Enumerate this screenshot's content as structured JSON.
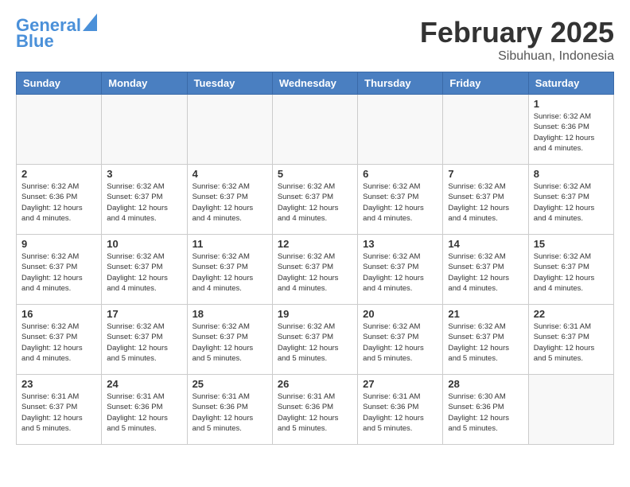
{
  "header": {
    "logo_line1": "General",
    "logo_line2": "Blue",
    "month_title": "February 2025",
    "subtitle": "Sibuhuan, Indonesia"
  },
  "weekdays": [
    "Sunday",
    "Monday",
    "Tuesday",
    "Wednesday",
    "Thursday",
    "Friday",
    "Saturday"
  ],
  "weeks": [
    [
      {
        "day": "",
        "info": ""
      },
      {
        "day": "",
        "info": ""
      },
      {
        "day": "",
        "info": ""
      },
      {
        "day": "",
        "info": ""
      },
      {
        "day": "",
        "info": ""
      },
      {
        "day": "",
        "info": ""
      },
      {
        "day": "1",
        "info": "Sunrise: 6:32 AM\nSunset: 6:36 PM\nDaylight: 12 hours\nand 4 minutes."
      }
    ],
    [
      {
        "day": "2",
        "info": "Sunrise: 6:32 AM\nSunset: 6:36 PM\nDaylight: 12 hours\nand 4 minutes."
      },
      {
        "day": "3",
        "info": "Sunrise: 6:32 AM\nSunset: 6:37 PM\nDaylight: 12 hours\nand 4 minutes."
      },
      {
        "day": "4",
        "info": "Sunrise: 6:32 AM\nSunset: 6:37 PM\nDaylight: 12 hours\nand 4 minutes."
      },
      {
        "day": "5",
        "info": "Sunrise: 6:32 AM\nSunset: 6:37 PM\nDaylight: 12 hours\nand 4 minutes."
      },
      {
        "day": "6",
        "info": "Sunrise: 6:32 AM\nSunset: 6:37 PM\nDaylight: 12 hours\nand 4 minutes."
      },
      {
        "day": "7",
        "info": "Sunrise: 6:32 AM\nSunset: 6:37 PM\nDaylight: 12 hours\nand 4 minutes."
      },
      {
        "day": "8",
        "info": "Sunrise: 6:32 AM\nSunset: 6:37 PM\nDaylight: 12 hours\nand 4 minutes."
      }
    ],
    [
      {
        "day": "9",
        "info": "Sunrise: 6:32 AM\nSunset: 6:37 PM\nDaylight: 12 hours\nand 4 minutes."
      },
      {
        "day": "10",
        "info": "Sunrise: 6:32 AM\nSunset: 6:37 PM\nDaylight: 12 hours\nand 4 minutes."
      },
      {
        "day": "11",
        "info": "Sunrise: 6:32 AM\nSunset: 6:37 PM\nDaylight: 12 hours\nand 4 minutes."
      },
      {
        "day": "12",
        "info": "Sunrise: 6:32 AM\nSunset: 6:37 PM\nDaylight: 12 hours\nand 4 minutes."
      },
      {
        "day": "13",
        "info": "Sunrise: 6:32 AM\nSunset: 6:37 PM\nDaylight: 12 hours\nand 4 minutes."
      },
      {
        "day": "14",
        "info": "Sunrise: 6:32 AM\nSunset: 6:37 PM\nDaylight: 12 hours\nand 4 minutes."
      },
      {
        "day": "15",
        "info": "Sunrise: 6:32 AM\nSunset: 6:37 PM\nDaylight: 12 hours\nand 4 minutes."
      }
    ],
    [
      {
        "day": "16",
        "info": "Sunrise: 6:32 AM\nSunset: 6:37 PM\nDaylight: 12 hours\nand 4 minutes."
      },
      {
        "day": "17",
        "info": "Sunrise: 6:32 AM\nSunset: 6:37 PM\nDaylight: 12 hours\nand 5 minutes."
      },
      {
        "day": "18",
        "info": "Sunrise: 6:32 AM\nSunset: 6:37 PM\nDaylight: 12 hours\nand 5 minutes."
      },
      {
        "day": "19",
        "info": "Sunrise: 6:32 AM\nSunset: 6:37 PM\nDaylight: 12 hours\nand 5 minutes."
      },
      {
        "day": "20",
        "info": "Sunrise: 6:32 AM\nSunset: 6:37 PM\nDaylight: 12 hours\nand 5 minutes."
      },
      {
        "day": "21",
        "info": "Sunrise: 6:32 AM\nSunset: 6:37 PM\nDaylight: 12 hours\nand 5 minutes."
      },
      {
        "day": "22",
        "info": "Sunrise: 6:31 AM\nSunset: 6:37 PM\nDaylight: 12 hours\nand 5 minutes."
      }
    ],
    [
      {
        "day": "23",
        "info": "Sunrise: 6:31 AM\nSunset: 6:37 PM\nDaylight: 12 hours\nand 5 minutes."
      },
      {
        "day": "24",
        "info": "Sunrise: 6:31 AM\nSunset: 6:36 PM\nDaylight: 12 hours\nand 5 minutes."
      },
      {
        "day": "25",
        "info": "Sunrise: 6:31 AM\nSunset: 6:36 PM\nDaylight: 12 hours\nand 5 minutes."
      },
      {
        "day": "26",
        "info": "Sunrise: 6:31 AM\nSunset: 6:36 PM\nDaylight: 12 hours\nand 5 minutes."
      },
      {
        "day": "27",
        "info": "Sunrise: 6:31 AM\nSunset: 6:36 PM\nDaylight: 12 hours\nand 5 minutes."
      },
      {
        "day": "28",
        "info": "Sunrise: 6:30 AM\nSunset: 6:36 PM\nDaylight: 12 hours\nand 5 minutes."
      },
      {
        "day": "",
        "info": ""
      }
    ]
  ]
}
